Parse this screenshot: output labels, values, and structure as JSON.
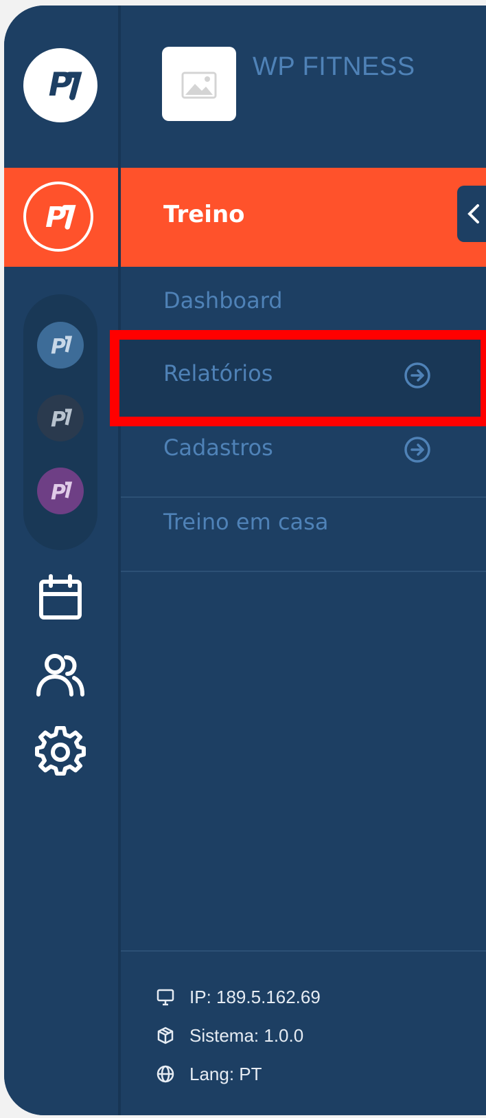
{
  "app": {
    "title": "WP FITNESS"
  },
  "colors": {
    "sidebar": "#1d3f63",
    "accent": "#ff522b",
    "link": "#4f82b7",
    "highlight": "#ff0000"
  },
  "rail": {
    "top_logo": "pacto-logo-icon",
    "active_module_logo": "pacto-logo-icon",
    "units": [
      "unit-blue-icon",
      "unit-dark-icon",
      "unit-purple-icon"
    ],
    "icons": [
      "calendar-icon",
      "users-icon",
      "gear-icon"
    ]
  },
  "menu": {
    "active_label": "Treino",
    "items": [
      {
        "label": "Dashboard",
        "has_arrow": false
      },
      {
        "label": "Relatórios",
        "has_arrow": true
      },
      {
        "label": "Cadastros",
        "has_arrow": true
      },
      {
        "label": "Treino em casa",
        "has_arrow": false
      }
    ]
  },
  "footer": {
    "ip": "IP: 189.5.162.69",
    "system": "Sistema: 1.0.0",
    "lang": "Lang: PT"
  }
}
